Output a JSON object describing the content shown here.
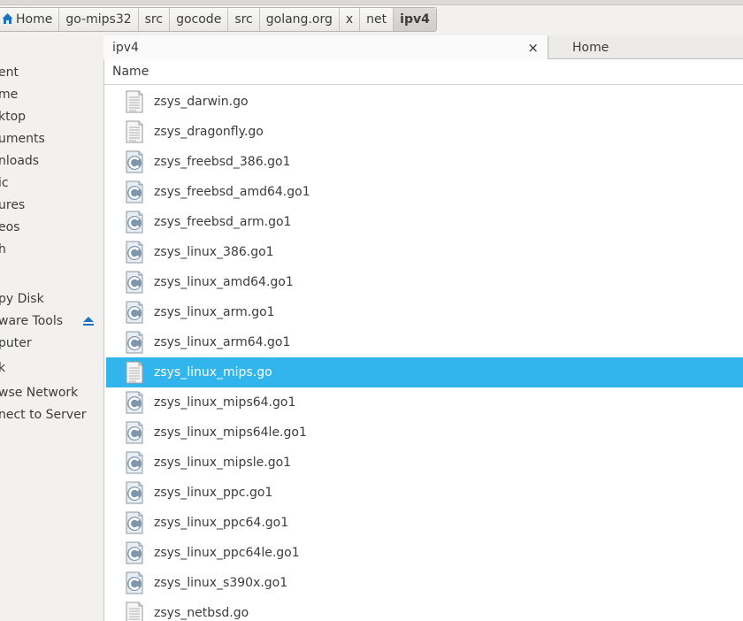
{
  "breadcrumb": [
    "Home",
    "go-mips32",
    "src",
    "gocode",
    "src",
    "golang.org",
    "x",
    "net",
    "ipv4"
  ],
  "sidebar": {
    "items": [
      "ent",
      "me",
      "ktop",
      "uments",
      "nloads",
      "ic",
      "ures",
      "eos",
      "h"
    ],
    "devices": [
      "py Disk",
      "ware Tools",
      "puter",
      "k"
    ],
    "network": [
      "wse Network",
      "nect to Server"
    ]
  },
  "tabs": [
    {
      "label": "ipv4",
      "close": "×"
    },
    {
      "label": "Home"
    }
  ],
  "list": {
    "header": "Name",
    "files": [
      {
        "name": "zsys_darwin.go",
        "icon": "text-file-icon"
      },
      {
        "name": "zsys_dragonfly.go",
        "icon": "text-file-icon"
      },
      {
        "name": "zsys_freebsd_386.go1",
        "icon": "c-source-file-icon"
      },
      {
        "name": "zsys_freebsd_amd64.go1",
        "icon": "c-source-file-icon"
      },
      {
        "name": "zsys_freebsd_arm.go1",
        "icon": "c-source-file-icon"
      },
      {
        "name": "zsys_linux_386.go1",
        "icon": "c-source-file-icon"
      },
      {
        "name": "zsys_linux_amd64.go1",
        "icon": "c-source-file-icon"
      },
      {
        "name": "zsys_linux_arm.go1",
        "icon": "c-source-file-icon"
      },
      {
        "name": "zsys_linux_arm64.go1",
        "icon": "c-source-file-icon"
      },
      {
        "name": "zsys_linux_mips.go",
        "icon": "text-file-icon",
        "selected": true
      },
      {
        "name": "zsys_linux_mips64.go1",
        "icon": "c-source-file-icon"
      },
      {
        "name": "zsys_linux_mips64le.go1",
        "icon": "c-source-file-icon"
      },
      {
        "name": "zsys_linux_mipsle.go1",
        "icon": "c-source-file-icon"
      },
      {
        "name": "zsys_linux_ppc.go1",
        "icon": "c-source-file-icon"
      },
      {
        "name": "zsys_linux_ppc64.go1",
        "icon": "c-source-file-icon"
      },
      {
        "name": "zsys_linux_ppc64le.go1",
        "icon": "c-source-file-icon"
      },
      {
        "name": "zsys_linux_s390x.go1",
        "icon": "c-source-file-icon"
      },
      {
        "name": "zsys_netbsd.go",
        "icon": "text-file-icon"
      }
    ]
  },
  "colors": {
    "selection": "#32b4ec",
    "folder_icon": "#1e73be"
  }
}
